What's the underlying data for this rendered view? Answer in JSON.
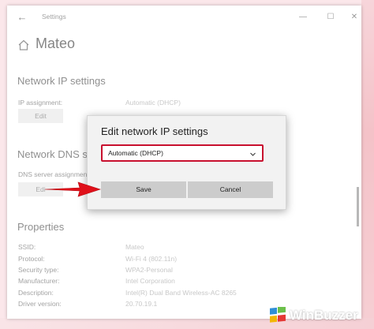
{
  "window": {
    "title": "Settings",
    "back_glyph": "←",
    "min_glyph": "—",
    "max_glyph": "☐",
    "close_glyph": "✕"
  },
  "page": {
    "title": "Mateo",
    "icon": "home-icon"
  },
  "ip_section": {
    "title": "Network IP settings",
    "label": "IP assignment:",
    "value": "Automatic (DHCP)",
    "edit_label": "Edit"
  },
  "dns_section": {
    "title": "Network DNS se",
    "label": "DNS server assignmen",
    "edit_label": "Edi"
  },
  "properties": {
    "title": "Properties",
    "rows": [
      {
        "label": "SSID:",
        "value": "Mateo"
      },
      {
        "label": "Protocol:",
        "value": "Wi-Fi 4 (802.11n)"
      },
      {
        "label": "Security type:",
        "value": "WPA2-Personal"
      },
      {
        "label": "Manufacturer:",
        "value": "Intel Corporation"
      },
      {
        "label": "Description:",
        "value": "Intel(R) Dual Band Wireless-AC 8265"
      },
      {
        "label": "Driver version:",
        "value": "20.70.19.1"
      }
    ]
  },
  "dialog": {
    "title": "Edit network IP settings",
    "selected_option": "Automatic (DHCP)",
    "save_label": "Save",
    "cancel_label": "Cancel"
  },
  "colors": {
    "highlight_red": "#c8102e",
    "arrow_red": "#e0101a"
  },
  "watermark": {
    "text": "WinBuzzer"
  }
}
